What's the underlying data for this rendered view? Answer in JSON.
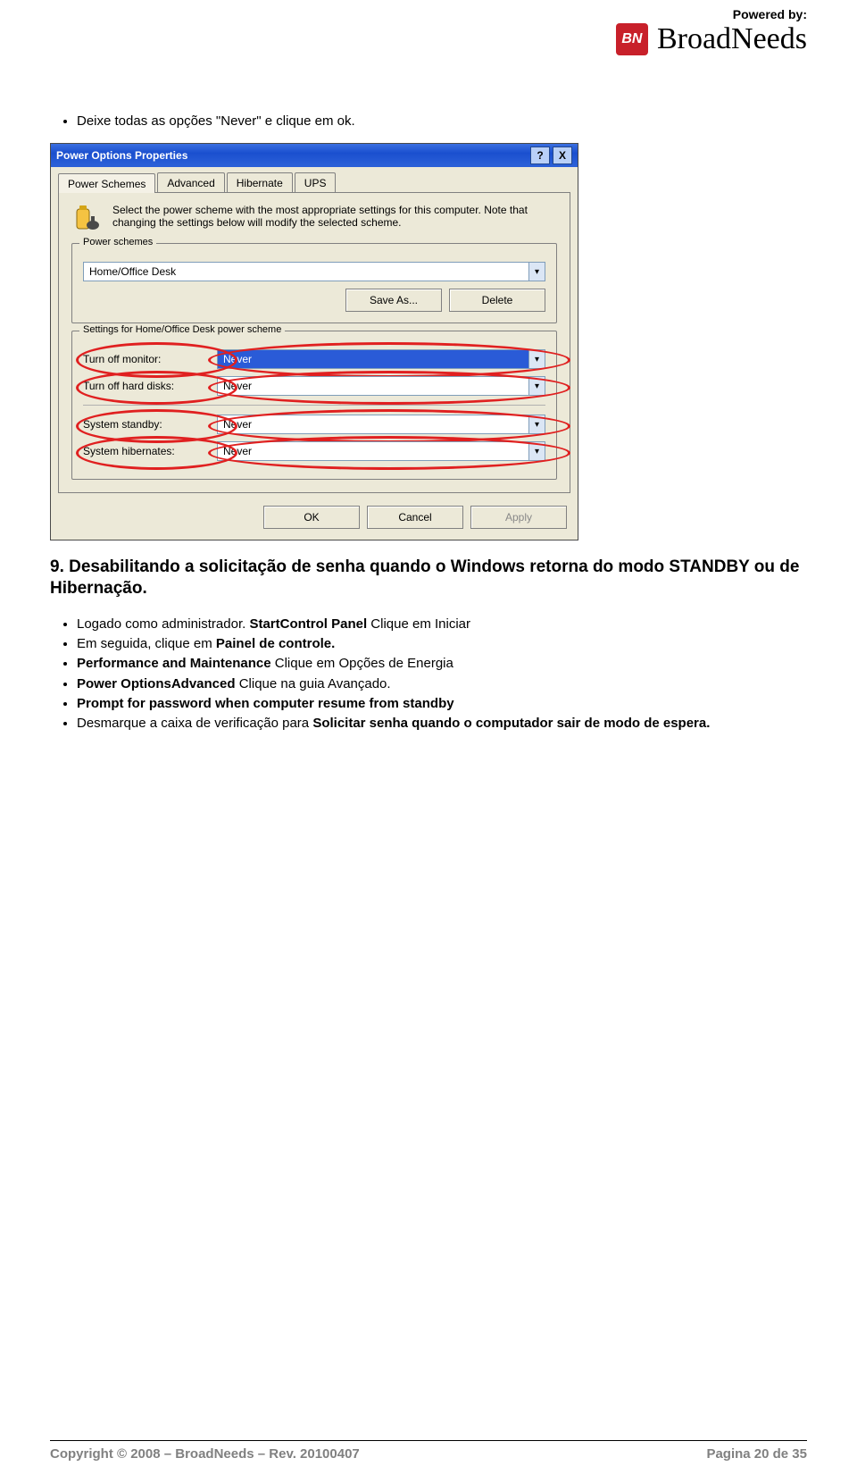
{
  "header": {
    "powered_by": "Powered by:",
    "logo_initials": "BN",
    "brand_name": "BroadNeeds"
  },
  "intro_bullet": "Deixe todas as opções \"Never\" e clique em ok.",
  "dialog": {
    "title": "Power Options Properties",
    "help_btn": "?",
    "close_btn": "X",
    "tabs": [
      "Power Schemes",
      "Advanced",
      "Hibernate",
      "UPS"
    ],
    "desc": "Select the power scheme with the most appropriate settings for this computer. Note that changing the settings below will modify the selected scheme.",
    "group1_title": "Power schemes",
    "scheme_value": "Home/Office Desk",
    "save_as": "Save As...",
    "delete": "Delete",
    "group2_title": "Settings for Home/Office Desk power scheme",
    "labels": {
      "monitor": "Turn off monitor:",
      "hdd": "Turn off hard disks:",
      "standby": "System standby:",
      "hibernate": "System hibernates:"
    },
    "values": {
      "monitor": "Never",
      "hdd": "Never",
      "standby": "Never",
      "hibernate": "Never"
    },
    "ok": "OK",
    "cancel": "Cancel",
    "apply": "Apply"
  },
  "section": {
    "heading": "9. Desabilitando a solicitação de senha quando o Windows retorna do modo STANDBY ou de Hibernação.",
    "bullets": [
      {
        "pre": "Logado como administrador. ",
        "bold": "StartControl Panel",
        "post": " Clique em Iniciar"
      },
      {
        "pre": "Em seguida, clique em ",
        "bold": "Painel de controle.",
        "post": ""
      },
      {
        "pre": "",
        "bold": "Performance and Maintenance",
        "post": " Clique em Opções de Energia"
      },
      {
        "pre": "",
        "bold": "Power OptionsAdvanced",
        "post": " Clique na guia Avançado."
      },
      {
        "pre": "",
        "bold": "Prompt for password when computer resume from standby",
        "post": ""
      },
      {
        "pre": "Desmarque a caixa de verificação para ",
        "bold": "Solicitar senha quando o computador sair de modo de espera.",
        "post": ""
      }
    ]
  },
  "footer": {
    "left": "Copyright © 2008 – BroadNeeds – Rev. 20100407",
    "right": "Pagina 20 de 35"
  }
}
